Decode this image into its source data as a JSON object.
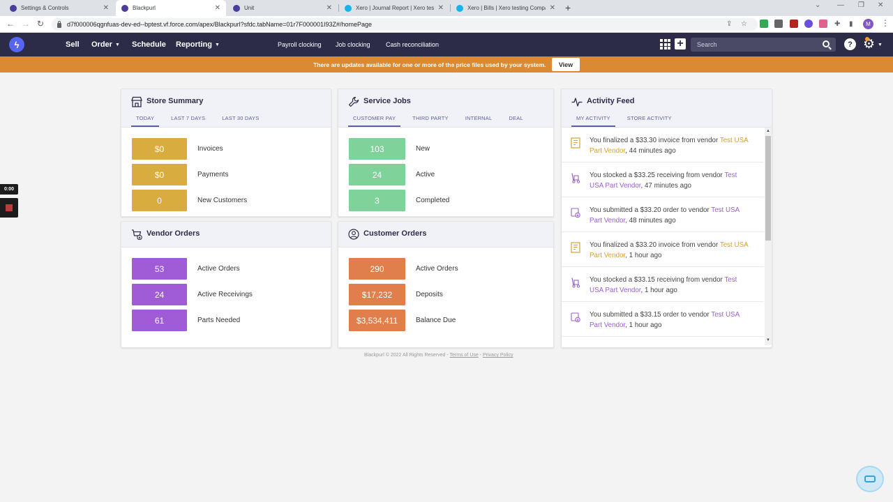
{
  "browser": {
    "tabs": [
      {
        "title": "Settings & Controls",
        "favicon": "blackpurl"
      },
      {
        "title": "Blackpurl",
        "favicon": "blackpurl",
        "active": true
      },
      {
        "title": "Unit",
        "favicon": "blackpurl"
      },
      {
        "title": "Xero | Journal Report | Xero testi",
        "favicon": "xero"
      },
      {
        "title": "Xero | Bills | Xero testing Compa",
        "favicon": "xero"
      }
    ],
    "url": "d7f000006qgnfuas-dev-ed--bptest.vf.force.com/apex/Blackpurl?sfdc.tabName=01r7F000001I93Z#/homePage",
    "profile_initial": "M"
  },
  "header": {
    "nav": [
      {
        "label": "Sell"
      },
      {
        "label": "Order",
        "dropdown": true
      },
      {
        "label": "Schedule"
      },
      {
        "label": "Reporting",
        "dropdown": true
      }
    ],
    "subnav": [
      "Payroll clocking",
      "Job clocking",
      "Cash reconciliation"
    ],
    "search_placeholder": "Search",
    "help_label": "?"
  },
  "banner": {
    "text": "There are updates available for one or more of the price files used by your system.",
    "button": "View"
  },
  "store_summary": {
    "title": "Store Summary",
    "tabs": [
      "TODAY",
      "LAST 7 DAYS",
      "LAST 30 DAYS"
    ],
    "color": "#d9ac3f",
    "stats": [
      {
        "value": "$0",
        "label": "Invoices"
      },
      {
        "value": "$0",
        "label": "Payments"
      },
      {
        "value": "0",
        "label": "New Customers"
      }
    ]
  },
  "service_jobs": {
    "title": "Service Jobs",
    "tabs": [
      "CUSTOMER PAY",
      "THIRD PARTY",
      "INTERNAL",
      "DEAL"
    ],
    "color": "#7fd39a",
    "stats": [
      {
        "value": "103",
        "label": "New"
      },
      {
        "value": "24",
        "label": "Active"
      },
      {
        "value": "3",
        "label": "Completed"
      }
    ]
  },
  "vendor_orders": {
    "title": "Vendor Orders",
    "color": "#a05cd6",
    "stats": [
      {
        "value": "53",
        "label": "Active Orders"
      },
      {
        "value": "24",
        "label": "Active Receivings"
      },
      {
        "value": "61",
        "label": "Parts Needed"
      }
    ]
  },
  "customer_orders": {
    "title": "Customer Orders",
    "color": "#e07e4c",
    "stats": [
      {
        "value": "290",
        "label": "Active Orders"
      },
      {
        "value": "$17,232",
        "label": "Deposits"
      },
      {
        "value": "$3,534,411",
        "label": "Balance Due"
      }
    ]
  },
  "activity_feed": {
    "title": "Activity Feed",
    "tabs": [
      "MY ACTIVITY",
      "STORE ACTIVITY"
    ],
    "items": [
      {
        "icon": "invoice-icon",
        "prefix": "You finalized a $33.30 invoice from vendor ",
        "vendor": "Test USA Part Vendor",
        "vendor_color": "orange",
        "suffix": ", 44 minutes ago"
      },
      {
        "icon": "hand-truck-icon",
        "prefix": "You stocked a $33.25 receiving from vendor ",
        "vendor": "Test USA Part Vendor",
        "vendor_color": "purple",
        "suffix": ", 47 minutes ago"
      },
      {
        "icon": "order-icon",
        "prefix": "You submitted a $33.20 order to vendor ",
        "vendor": "Test USA Part Vendor",
        "vendor_color": "purple",
        "suffix": ", 48 minutes ago"
      },
      {
        "icon": "invoice-icon",
        "prefix": "You finalized a $33.20 invoice from vendor ",
        "vendor": "Test USA Part Vendor",
        "vendor_color": "orange",
        "suffix": ", 1 hour ago"
      },
      {
        "icon": "hand-truck-icon",
        "prefix": "You stocked a $33.15 receiving from vendor ",
        "vendor": "Test USA Part Vendor",
        "vendor_color": "purple",
        "suffix": ", 1 hour ago"
      },
      {
        "icon": "order-icon",
        "prefix": "You submitted a $33.15 order to vendor ",
        "vendor": "Test USA Part Vendor",
        "vendor_color": "purple",
        "suffix": ", 1 hour ago"
      }
    ]
  },
  "footer": {
    "text": "Blackpurl © 2022 All Rights Reserved - ",
    "terms": "Terms of Use",
    "separator": " - ",
    "privacy": "Privacy Policy"
  },
  "recorder": {
    "time": "0:00"
  }
}
